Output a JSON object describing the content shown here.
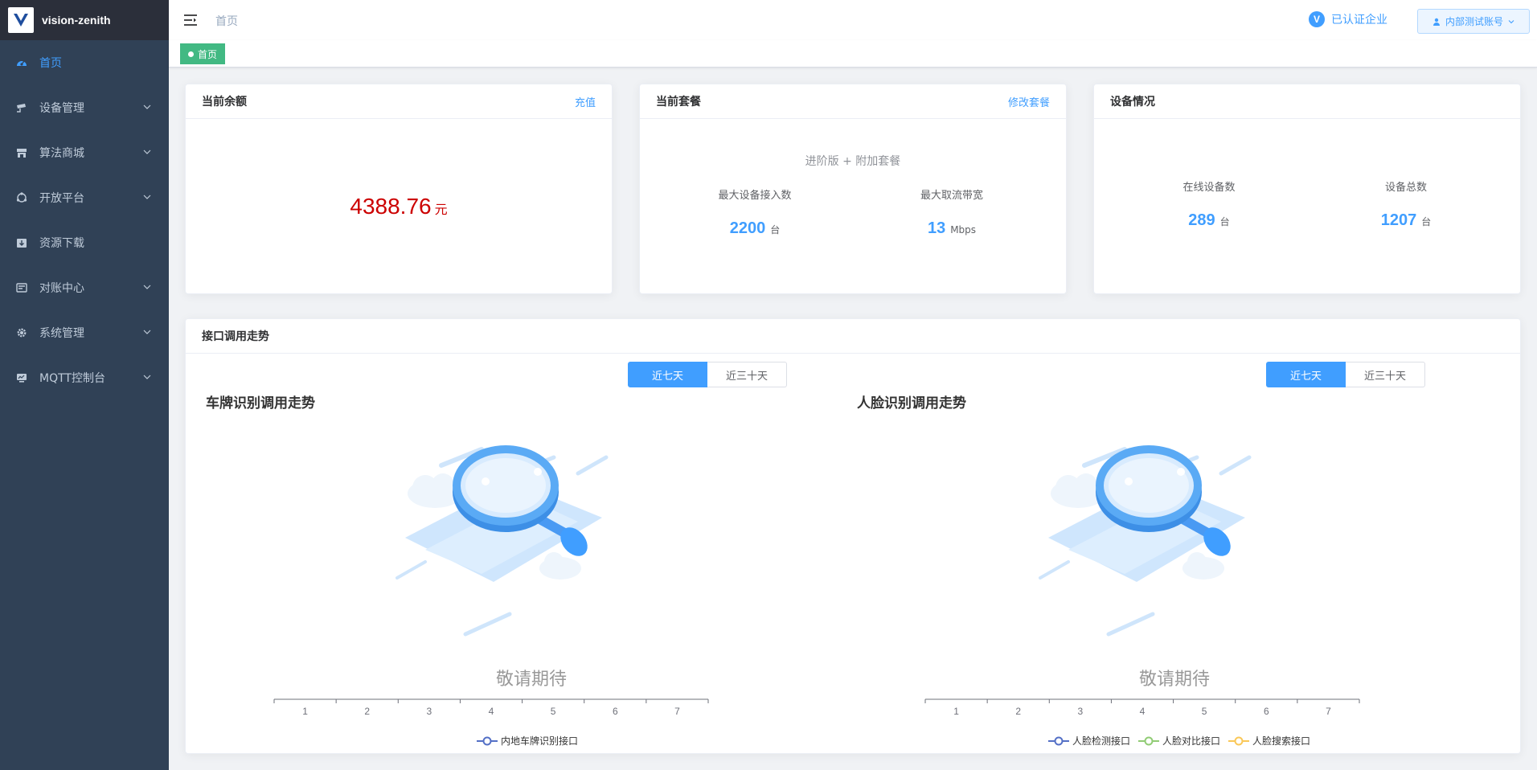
{
  "brand": {
    "name": "vision-zenith"
  },
  "sidebar": {
    "items": [
      {
        "label": "首页",
        "icon": "dashboard-icon",
        "active": true,
        "expandable": false
      },
      {
        "label": "设备管理",
        "icon": "camera-icon",
        "active": false,
        "expandable": true
      },
      {
        "label": "算法商城",
        "icon": "shop-icon",
        "active": false,
        "expandable": true
      },
      {
        "label": "开放平台",
        "icon": "open-platform-icon",
        "active": false,
        "expandable": true
      },
      {
        "label": "资源下载",
        "icon": "download-icon",
        "active": false,
        "expandable": false
      },
      {
        "label": "对账中心",
        "icon": "billing-icon",
        "active": false,
        "expandable": true
      },
      {
        "label": "系统管理",
        "icon": "gear-icon",
        "active": false,
        "expandable": true
      },
      {
        "label": "MQTT控制台",
        "icon": "monitor-icon",
        "active": false,
        "expandable": true
      }
    ]
  },
  "header": {
    "breadcrumb": "首页",
    "cert_badge": "V",
    "cert_label": "已认证企业",
    "account_label": "内部测试账号"
  },
  "tags": {
    "active": "首页"
  },
  "balance_card": {
    "title": "当前余额",
    "action": "充值",
    "amount": "4388.76",
    "unit": "元"
  },
  "package_card": {
    "title": "当前套餐",
    "action": "修改套餐",
    "package_name": "进阶版 + 附加套餐",
    "stats": [
      {
        "label": "最大设备接入数",
        "value": "2200",
        "unit": "台"
      },
      {
        "label": "最大取流带宽",
        "value": "13",
        "unit": "Mbps"
      }
    ]
  },
  "device_card": {
    "title": "设备情况",
    "stats": [
      {
        "label": "在线设备数",
        "value": "289",
        "unit": "台"
      },
      {
        "label": "设备总数",
        "value": "1207",
        "unit": "台"
      }
    ]
  },
  "trend": {
    "title": "接口调用走势",
    "range_options": [
      "近七天",
      "近三十天"
    ],
    "selected_range": "近七天",
    "empty_text": "敬请期待"
  },
  "colors": {
    "primary": "#409eff",
    "sidebar_bg": "#304156",
    "tag_green": "#42b983",
    "balance_red": "#cc0000"
  },
  "chart_data": [
    {
      "type": "line",
      "title": "车牌识别调用走势",
      "categories": [
        "1",
        "2",
        "3",
        "4",
        "5",
        "6",
        "7"
      ],
      "series": [
        {
          "name": "内地车牌识别接口",
          "values": [],
          "color": "#5470c6"
        }
      ],
      "legend": "bottom",
      "grid": false
    },
    {
      "type": "line",
      "title": "人脸识别调用走势",
      "categories": [
        "1",
        "2",
        "3",
        "4",
        "5",
        "6",
        "7"
      ],
      "series": [
        {
          "name": "人脸检测接口",
          "values": [],
          "color": "#5470c6"
        },
        {
          "name": "人脸对比接口",
          "values": [],
          "color": "#91cc75"
        },
        {
          "name": "人脸搜索接口",
          "values": [],
          "color": "#fac858"
        }
      ],
      "legend": "bottom",
      "grid": false
    }
  ]
}
